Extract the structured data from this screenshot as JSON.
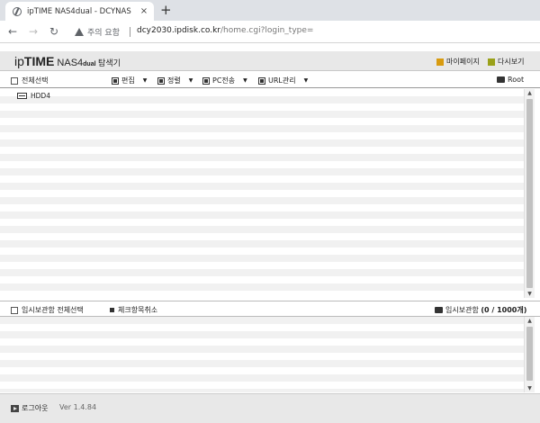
{
  "browser": {
    "tab_title": "ipTIME NAS4dual - DCYNAS",
    "close_glyph": "×",
    "newtab_glyph": "+",
    "back_glyph": "←",
    "forward_glyph": "→",
    "reload_glyph": "↻",
    "security_text": "주의 요함",
    "url_host": "dcy2030.ipdisk.co.kr",
    "url_path": "/home.cgi?login_type="
  },
  "header": {
    "logo_ip": "ip",
    "logo_time": "TIME",
    "logo_model": " NAS4",
    "logo_dual": "dual",
    "logo_explorer": " 탐색기",
    "mypage_label": "마이페이지",
    "reload_label": "다시보기"
  },
  "toolbar": {
    "select_all": "전체선택",
    "edit": "편집",
    "sort": "정렬",
    "pc_transfer": "PC전송",
    "url_manage": "URL관리",
    "caret": "▼",
    "root": "Root"
  },
  "files": [
    {
      "name": "HDD4"
    }
  ],
  "scroll": {
    "up": "▲",
    "down": "▼"
  },
  "temp": {
    "select_all": "임시보관함 전체선택",
    "uncheck": "체크항목취소",
    "box_label": "임시보관함",
    "count": "(0 / 1000개)"
  },
  "footer": {
    "logout": "로그아웃",
    "version": "Ver 1.4.84"
  }
}
